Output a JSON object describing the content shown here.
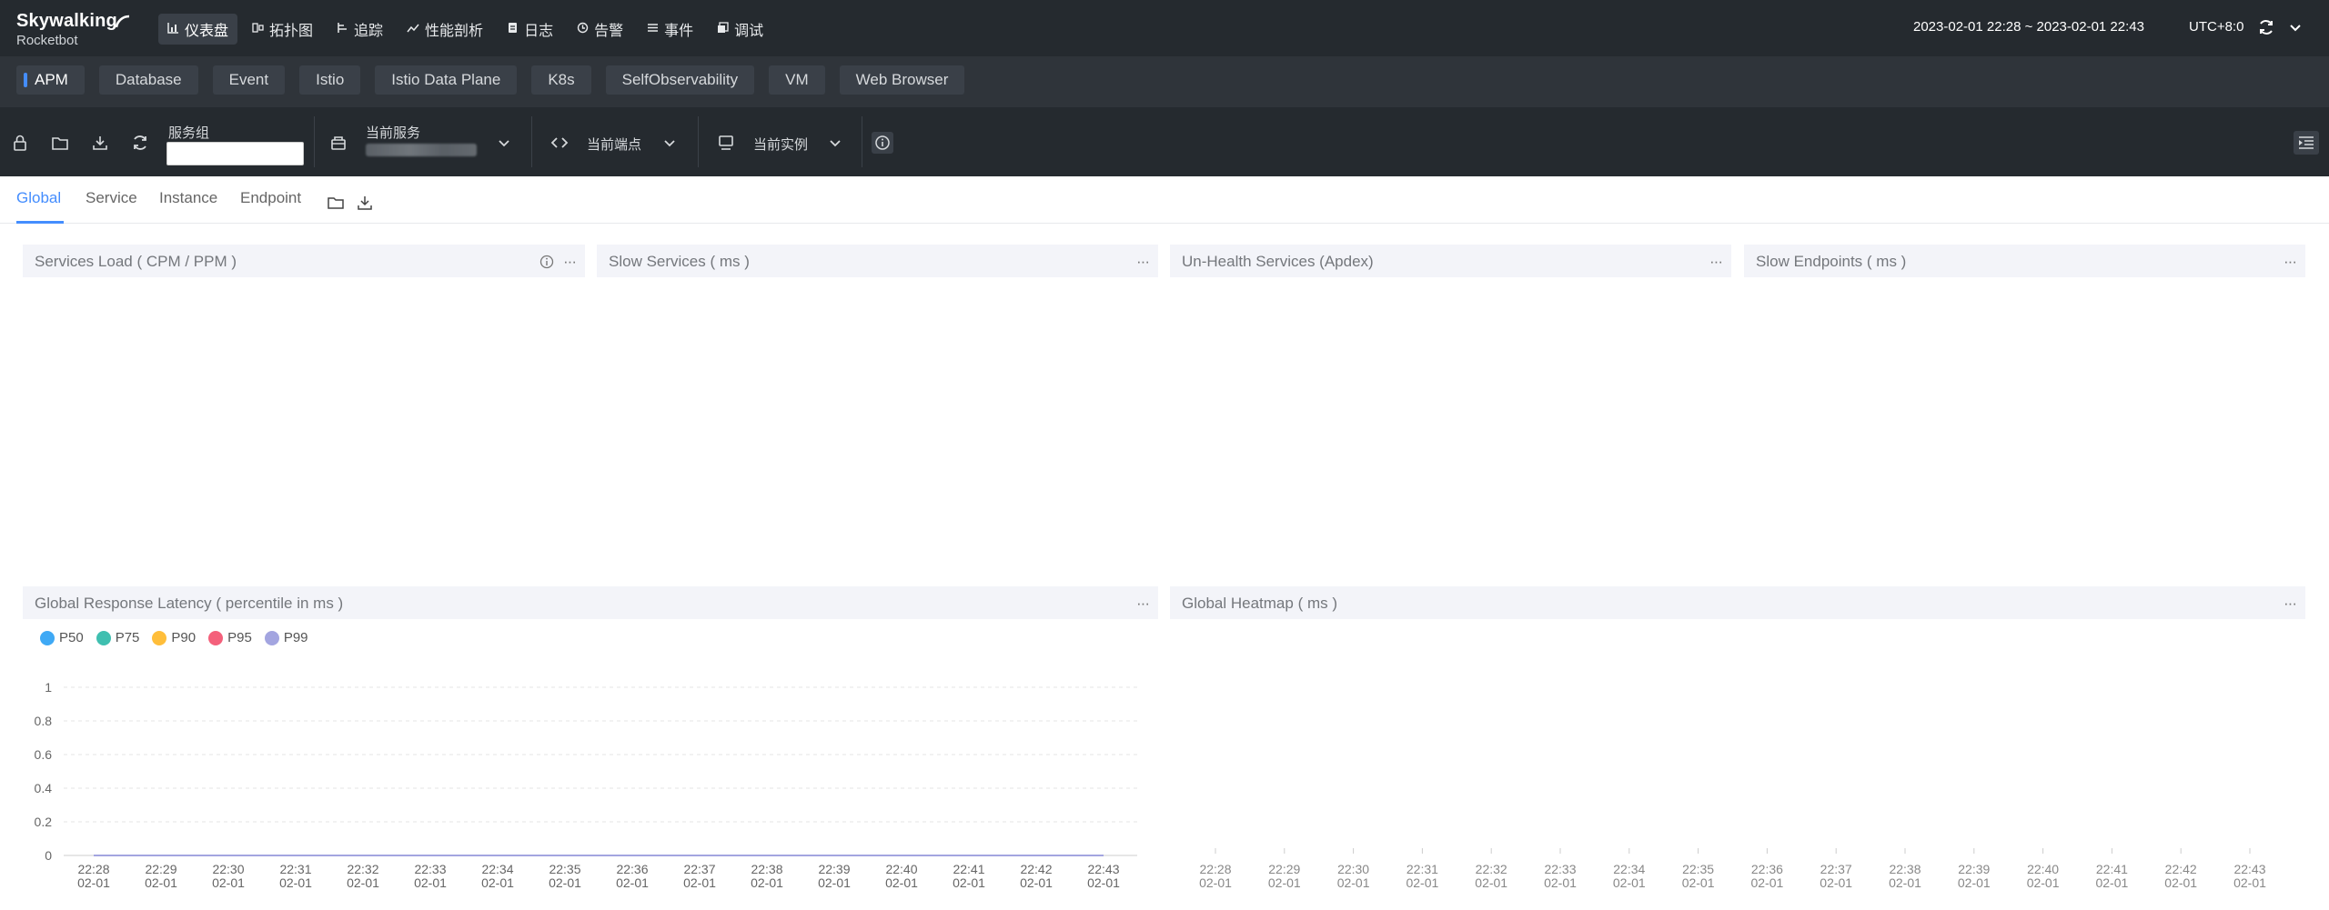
{
  "app": {
    "logo_main": "Skywalking",
    "logo_sub": "Rocketbot"
  },
  "nav": [
    {
      "label": "仪表盘",
      "icon": "dashboard-icon",
      "active": true
    },
    {
      "label": "拓扑图",
      "icon": "topology-icon",
      "active": false
    },
    {
      "label": "追踪",
      "icon": "trace-icon",
      "active": false
    },
    {
      "label": "性能剖析",
      "icon": "profile-icon",
      "active": false
    },
    {
      "label": "日志",
      "icon": "log-icon",
      "active": false
    },
    {
      "label": "告警",
      "icon": "alarm-icon",
      "active": false
    },
    {
      "label": "事件",
      "icon": "event-icon",
      "active": false
    },
    {
      "label": "调试",
      "icon": "debug-icon",
      "active": false
    }
  ],
  "header": {
    "time_range": "2023-02-01 22:28 ~ 2023-02-01 22:43",
    "timezone": "UTC+8:0"
  },
  "layers": [
    "APM",
    "Database",
    "Event",
    "Istio",
    "Istio Data Plane",
    "K8s",
    "SelfObservability",
    "VM",
    "Web Browser"
  ],
  "toolbar": {
    "service_group_label": "服务组",
    "service_group_value": "",
    "current_service_label": "当前服务",
    "current_endpoint_label": "当前端点",
    "current_instance_label": "当前实例"
  },
  "dashboard_tabs": [
    "Global",
    "Service",
    "Instance",
    "Endpoint"
  ],
  "widgets": {
    "services_load": "Services Load ( CPM / PPM )",
    "slow_services": "Slow Services ( ms )",
    "unhealth_services": "Un-Health Services (Apdex)",
    "slow_endpoints": "Slow Endpoints ( ms )",
    "global_latency": "Global Response Latency ( percentile in ms )",
    "global_heatmap": "Global Heatmap ( ms )",
    "more": "···"
  },
  "colors": {
    "accent": "#448dfe",
    "topbar": "#252a2f",
    "p50": "#3fa9f5",
    "p75": "#3fbfb0",
    "p90": "#ffbe3a",
    "p95": "#f4607b",
    "p99": "#a3a5e0"
  },
  "chart_data": [
    {
      "type": "line",
      "title": "Global Response Latency ( percentile in ms )",
      "xlabel": "",
      "ylabel": "",
      "x": [
        "22:28",
        "22:29",
        "22:30",
        "22:31",
        "22:32",
        "22:33",
        "22:34",
        "22:35",
        "22:36",
        "22:37",
        "22:38",
        "22:39",
        "22:40",
        "22:41",
        "22:42",
        "22:43"
      ],
      "x_date": "02-01",
      "y_ticks": [
        "1",
        "0.8",
        "0.6",
        "0.4",
        "0.2",
        "0"
      ],
      "ylim": [
        0,
        1
      ],
      "grid": true,
      "legend": "top-left",
      "series": [
        {
          "name": "P50",
          "values": [
            0,
            0,
            0,
            0,
            0,
            0,
            0,
            0,
            0,
            0,
            0,
            0,
            0,
            0,
            0,
            0
          ]
        },
        {
          "name": "P75",
          "values": [
            0,
            0,
            0,
            0,
            0,
            0,
            0,
            0,
            0,
            0,
            0,
            0,
            0,
            0,
            0,
            0
          ]
        },
        {
          "name": "P90",
          "values": [
            0,
            0,
            0,
            0,
            0,
            0,
            0,
            0,
            0,
            0,
            0,
            0,
            0,
            0,
            0,
            0
          ]
        },
        {
          "name": "P95",
          "values": [
            0,
            0,
            0,
            0,
            0,
            0,
            0,
            0,
            0,
            0,
            0,
            0,
            0,
            0,
            0,
            0
          ]
        },
        {
          "name": "P99",
          "values": [
            0,
            0,
            0,
            0,
            0,
            0,
            0,
            0,
            0,
            0,
            0,
            0,
            0,
            0,
            0,
            0
          ]
        }
      ]
    },
    {
      "type": "heatmap",
      "title": "Global Heatmap ( ms )",
      "x": [
        "22:28",
        "22:29",
        "22:30",
        "22:31",
        "22:32",
        "22:33",
        "22:34",
        "22:35",
        "22:36",
        "22:37",
        "22:38",
        "22:39",
        "22:40",
        "22:41",
        "22:42",
        "22:43"
      ],
      "x_date": "02-01",
      "values": []
    }
  ]
}
